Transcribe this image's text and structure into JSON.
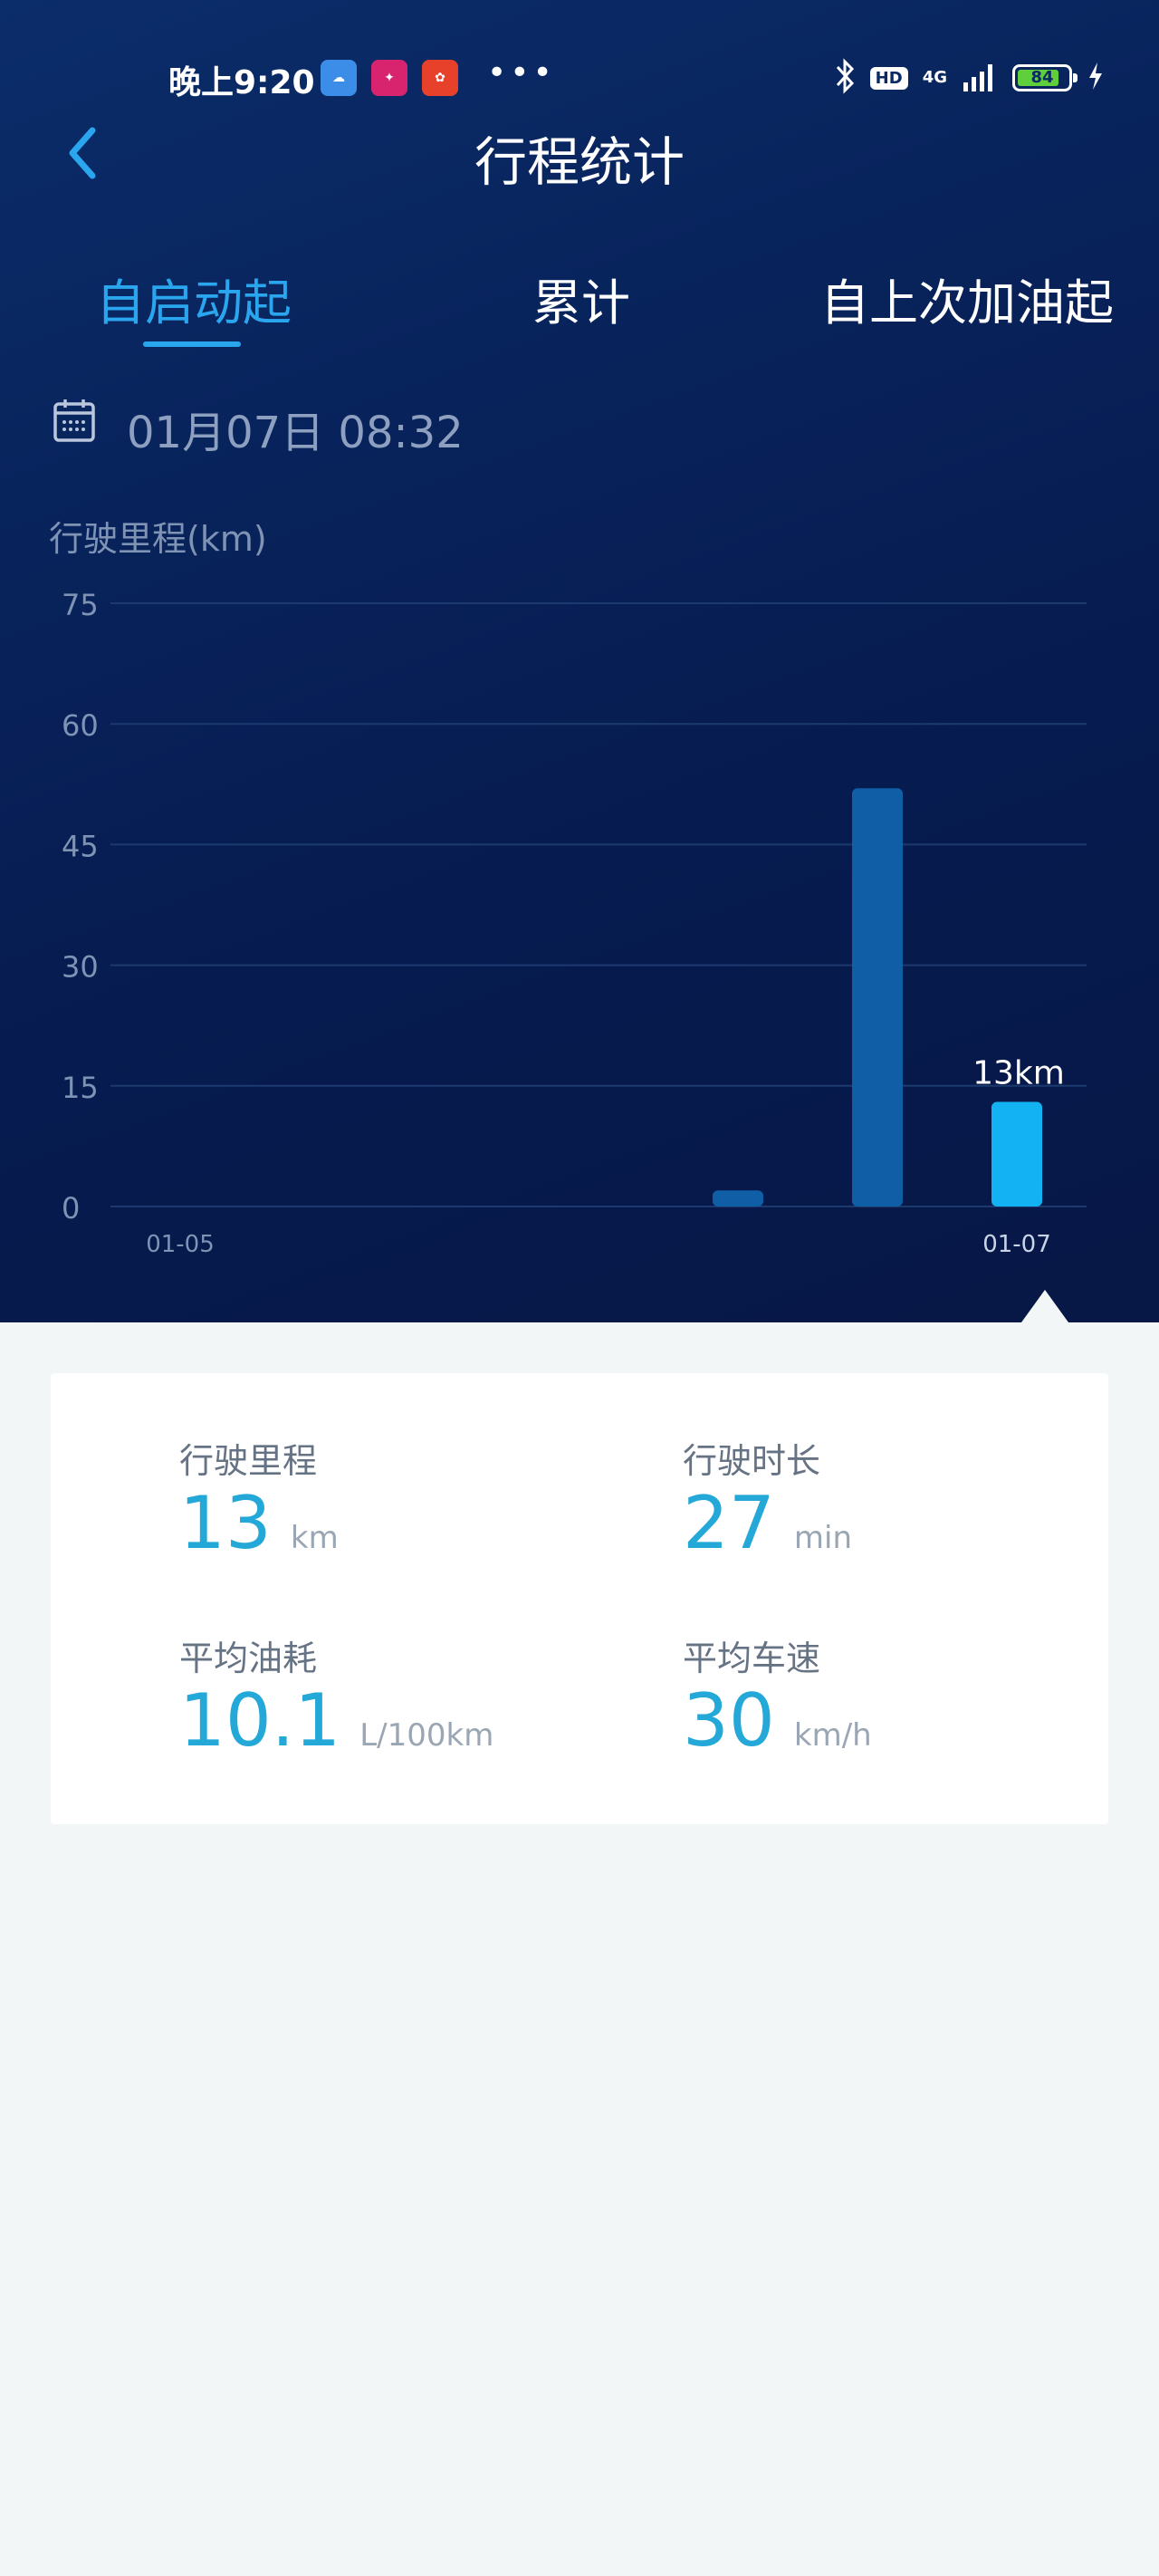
{
  "status_bar": {
    "time": "晚上9:20",
    "icons": [
      "weather-app-icon",
      "vip-app-icon",
      "red-app-icon"
    ],
    "more": "•••",
    "hd": "HD",
    "network": "4G",
    "battery": "84",
    "battery_level": 0.84
  },
  "header": {
    "title": "行程统计"
  },
  "tabs": [
    {
      "label": "自启动起",
      "active": true
    },
    {
      "label": "累计",
      "active": false
    },
    {
      "label": "自上次加油起",
      "active": false
    }
  ],
  "date": {
    "text": "01月07日 08:32"
  },
  "chart_data": {
    "type": "bar",
    "ylabel": "行驶里程(km)",
    "ylim": [
      0,
      75
    ],
    "yticks": [
      0,
      15,
      30,
      45,
      60,
      75
    ],
    "x_tick_labels": [
      "01-05",
      "01-07"
    ],
    "values": [
      0,
      0,
      0,
      0,
      2,
      52,
      13
    ],
    "highlight_index": 6,
    "highlight_label": "13km",
    "grid": true,
    "colors": {
      "bar": "#0f5ea6",
      "highlight": "#13b3f3",
      "grid": "#1d3a6f",
      "tick": "#7f93b4"
    }
  },
  "stats": [
    {
      "label": "行驶里程",
      "value": "13",
      "unit": "km"
    },
    {
      "label": "行驶时长",
      "value": "27",
      "unit": "min"
    },
    {
      "label": "平均油耗",
      "value": "10.1",
      "unit": "L/100km"
    },
    {
      "label": "平均车速",
      "value": "30",
      "unit": "km/h"
    }
  ],
  "colors": {
    "accent": "#2aa6ee",
    "value": "#23a8d8",
    "background": "#f3f6f7"
  }
}
